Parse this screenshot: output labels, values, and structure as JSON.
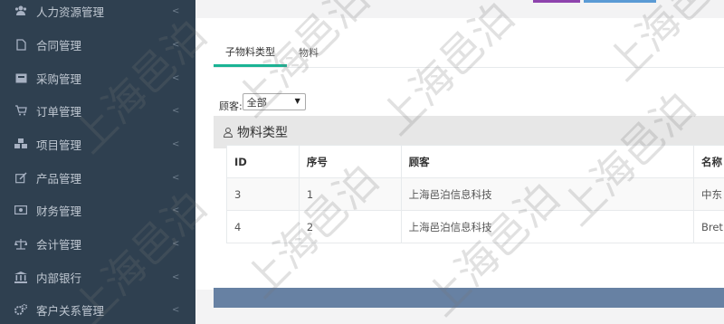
{
  "sidebar": {
    "items": [
      {
        "label": "人力资源管理",
        "icon": "users-icon"
      },
      {
        "label": "合同管理",
        "icon": "file-icon"
      },
      {
        "label": "采购管理",
        "icon": "inbox-icon"
      },
      {
        "label": "订单管理",
        "icon": "cart-icon"
      },
      {
        "label": "项目管理",
        "icon": "cubes-icon"
      },
      {
        "label": "产品管理",
        "icon": "edit-icon"
      },
      {
        "label": "财务管理",
        "icon": "money-icon"
      },
      {
        "label": "会计管理",
        "icon": "balance-icon"
      },
      {
        "label": "内部银行",
        "icon": "bank-icon"
      },
      {
        "label": "客户关系管理",
        "icon": "cogs-icon"
      }
    ]
  },
  "tabs": [
    {
      "label": "子物料类型",
      "active": true
    },
    {
      "label": "物料",
      "active": false
    }
  ],
  "filter": {
    "label": "顾客:",
    "selected": "全部"
  },
  "section": {
    "title": "物料类型",
    "icon": "user-icon"
  },
  "table": {
    "headers": [
      "ID",
      "序号",
      "顾客",
      "名称"
    ],
    "rows": [
      [
        "3",
        "1",
        "上海邑泊信息科技",
        "中东"
      ],
      [
        "4",
        "2",
        "上海邑泊信息科技",
        "Bret"
      ]
    ]
  },
  "watermark": "上海邑泊",
  "colors": {
    "sidebar": "#2f4050",
    "tab_accent": "#1ab394",
    "footer_bar": "#6781a3"
  }
}
